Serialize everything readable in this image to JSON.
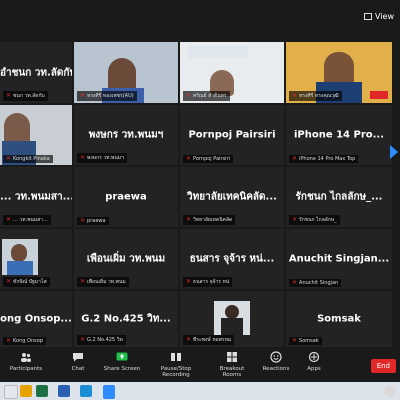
{
  "topbar": {
    "view_label": "View"
  },
  "tiles": [
    {
      "name": "อำชนก วท.ลัดกับ",
      "label": "ชนก วท.ลัดกับ"
    },
    {
      "name": "",
      "label": "ทรงศิรี ทองเพชร(AU)"
    },
    {
      "name": "",
      "label": "ศรัณย์ ลำต้นทร"
    },
    {
      "name": "",
      "label": "ทรงศิรี ทรงคุณวุฒิ"
    },
    {
      "name": "",
      "label": "Kongkit Pinaka"
    },
    {
      "name": "พงษกร วท.พนมฯ",
      "label": "พงษกร วท.พนมฯ"
    },
    {
      "name": "Pornpoj Pairsiri",
      "label": "Pornpoj Pairsiri"
    },
    {
      "name": "iPhone 14 Pro...",
      "label": "iPhone 14 Pro Max Top"
    },
    {
      "name": "... วท.พนมสา...",
      "label": "... วท.พนมสา..."
    },
    {
      "name": "praewa",
      "label": "praewa"
    },
    {
      "name": "วิทยาลัยเทคนิคลัด...",
      "label": "วิทยาลัยเทคนิคลัด"
    },
    {
      "name": "รักชนก ไกลลักษ_...",
      "label": "รักชนก ไกลลักษ_"
    },
    {
      "name": "",
      "label": "ทักษิณ์ ปัฐมาโส"
    },
    {
      "name": "เพือนเผิ่ม วท.พนม",
      "label": "เพือนเผิ่ม วท.พนม"
    },
    {
      "name": "ธนสาร จุจ้าร หน่...",
      "label": "ธนสาร จุจ้าร หน่"
    },
    {
      "name": "Anuchit Singjan...",
      "label": "Anuchit Singjan"
    },
    {
      "name": "ong Onsop...",
      "label": "Kong Onsop"
    },
    {
      "name": "G.2 No.425 วิท...",
      "label": "G.2 No.425 วิท"
    },
    {
      "name": "",
      "label": "พีระพงษ์ หอพรหม"
    },
    {
      "name": "Somsak",
      "label": "Somsak"
    }
  ],
  "toolbar": {
    "participants": "Participants",
    "chat": "Chat",
    "share": "Share Screen",
    "record": "Pause/Stop Recording",
    "breakout": "Breakout Rooms",
    "reactions": "Reactions",
    "apps": "Apps",
    "end": "End"
  }
}
